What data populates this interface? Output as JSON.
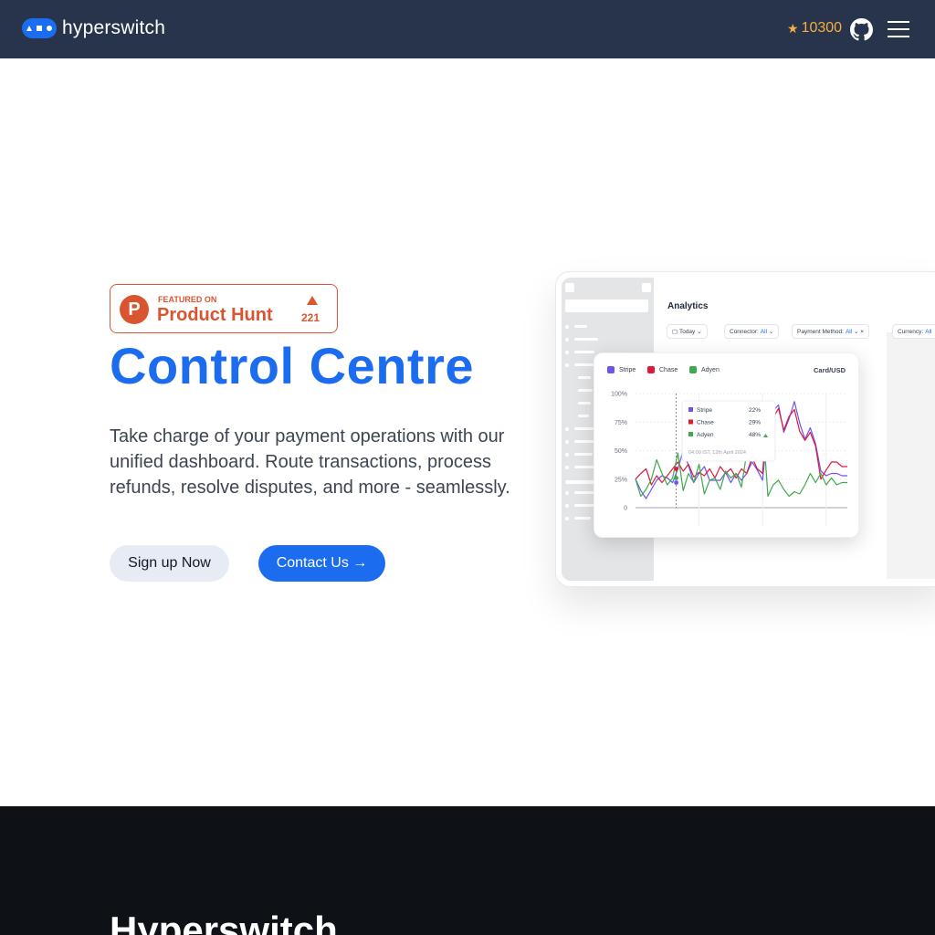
{
  "header": {
    "logo_text": "hyperswitch",
    "github_stars": "10300",
    "icons": [
      "star-icon",
      "github-icon",
      "menu-icon"
    ]
  },
  "hero": {
    "badge": {
      "small": "FEATURED ON",
      "name": "Product Hunt",
      "count": "221",
      "logo_letter": "P"
    },
    "title": "Control Centre",
    "description": "Take charge of your payment operations with our unified dashboard. Route transactions, process refunds, resolve disputes, and more - seamlessly.",
    "signup_label": "Sign up Now",
    "contact_label": "Contact Us →"
  },
  "dashboard": {
    "title": "Analytics",
    "filters": [
      {
        "label": "Today",
        "value": ""
      },
      {
        "label": "Connector:",
        "value": "All"
      },
      {
        "label": "Payment Method:",
        "value": "All"
      },
      {
        "label": "Currency:",
        "value": "All"
      }
    ],
    "card_tag": "Card/USD",
    "legend": [
      "Stripe",
      "Chase",
      "Adyen"
    ],
    "tooltip": {
      "rows": [
        {
          "name": "Stripe",
          "value": "22%"
        },
        {
          "name": "Chase",
          "value": "29%"
        },
        {
          "name": "Adyen",
          "value": "48%"
        }
      ],
      "timestamp": "04:00 IST, 12th April 2024"
    }
  },
  "chart_data": {
    "type": "line",
    "title": "",
    "ylim": [
      0,
      100
    ],
    "yticks": [
      "100%",
      "75%",
      "50%",
      "25%",
      "0"
    ],
    "x": [
      0,
      1,
      2,
      3,
      4,
      5,
      6,
      7,
      8,
      9,
      10,
      11,
      12,
      13,
      14,
      15,
      16,
      17,
      18,
      19,
      20,
      21,
      22,
      23,
      24,
      25,
      26,
      27,
      28,
      29,
      30,
      31,
      32,
      33,
      34,
      35,
      36,
      37,
      38,
      39,
      40
    ],
    "series": [
      {
        "name": "Stripe",
        "color": "#6a55f0",
        "values": [
          25,
          15,
          8,
          16,
          24,
          28,
          26,
          22,
          34,
          50,
          37,
          22,
          30,
          36,
          24,
          24,
          24,
          31,
          22,
          30,
          24,
          30,
          40,
          33,
          24,
          74,
          85,
          90,
          66,
          78,
          93,
          74,
          60,
          70,
          56,
          32,
          28,
          30,
          30,
          28,
          28
        ]
      },
      {
        "name": "Chase",
        "color": "#e0193a",
        "values": [
          25,
          30,
          34,
          20,
          28,
          22,
          28,
          34,
          40,
          32,
          38,
          27,
          31,
          28,
          34,
          26,
          36,
          30,
          34,
          26,
          34,
          30,
          44,
          34,
          30,
          86,
          79,
          87,
          68,
          80,
          86,
          67,
          59,
          66,
          54,
          25,
          33,
          40,
          40,
          36,
          36
        ]
      },
      {
        "name": "Adyen",
        "color": "#3fa94e",
        "values": [
          25,
          10,
          16,
          25,
          42,
          30,
          20,
          26,
          48,
          15,
          30,
          22,
          38,
          12,
          24,
          26,
          16,
          32,
          26,
          30,
          18,
          48,
          44,
          48,
          78,
          10,
          20,
          24,
          16,
          10,
          14,
          12,
          20,
          30,
          22,
          30,
          20,
          26,
          20,
          22,
          22
        ]
      }
    ]
  },
  "footer_section": {
    "title": "Hyperswitch"
  }
}
